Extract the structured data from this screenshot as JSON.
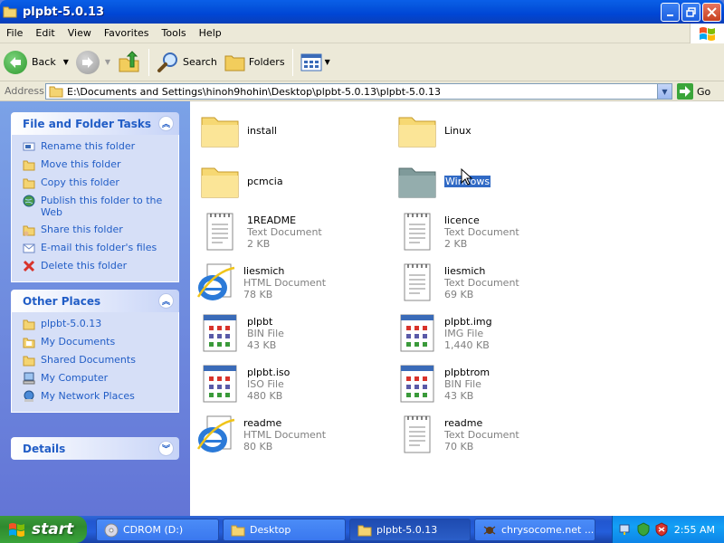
{
  "window": {
    "title": "plpbt-5.0.13"
  },
  "menu": [
    "File",
    "Edit",
    "View",
    "Favorites",
    "Tools",
    "Help"
  ],
  "toolbar": {
    "back": "Back",
    "search": "Search",
    "folders": "Folders"
  },
  "address": {
    "label": "Address",
    "path": "E:\\Documents and Settings\\hinoh9hohin\\Desktop\\plpbt-5.0.13\\plpbt-5.0.13",
    "go": "Go"
  },
  "tasks_panel": {
    "title": "File and Folder Tasks",
    "items": [
      "Rename this folder",
      "Move this folder",
      "Copy this folder",
      "Publish this folder to the Web",
      "Share this folder",
      "E-mail this folder's files",
      "Delete this folder"
    ]
  },
  "places_panel": {
    "title": "Other Places",
    "items": [
      "plpbt-5.0.13",
      "My Documents",
      "Shared Documents",
      "My Computer",
      "My Network Places"
    ]
  },
  "details_panel": {
    "title": "Details"
  },
  "files": [
    {
      "name": "install",
      "type": "",
      "size": "",
      "icon": "folder-icon"
    },
    {
      "name": "Linux",
      "type": "",
      "size": "",
      "icon": "folder-icon"
    },
    {
      "name": "pcmcia",
      "type": "",
      "size": "",
      "icon": "folder-icon"
    },
    {
      "name": "Windows",
      "type": "",
      "size": "",
      "icon": "folder-icon"
    },
    {
      "name": "1README",
      "type": "Text Document",
      "size": "2 KB",
      "icon": "text-document-icon"
    },
    {
      "name": "licence",
      "type": "Text Document",
      "size": "2 KB",
      "icon": "text-document-icon"
    },
    {
      "name": "liesmich",
      "type": "HTML Document",
      "size": "78 KB",
      "icon": "ie-html-icon"
    },
    {
      "name": "liesmich",
      "type": "Text Document",
      "size": "69 KB",
      "icon": "text-document-icon"
    },
    {
      "name": "plpbt",
      "type": "BIN File",
      "size": "43 KB",
      "icon": "binary-file-icon"
    },
    {
      "name": "plpbt.img",
      "type": "IMG File",
      "size": "1,440 KB",
      "icon": "binary-file-icon"
    },
    {
      "name": "plpbt.iso",
      "type": "ISO File",
      "size": "480 KB",
      "icon": "binary-file-icon"
    },
    {
      "name": "plpbtrom",
      "type": "BIN File",
      "size": "43 KB",
      "icon": "binary-file-icon"
    },
    {
      "name": "readme",
      "type": "HTML Document",
      "size": "80 KB",
      "icon": "ie-html-icon"
    },
    {
      "name": "readme",
      "type": "Text Document",
      "size": "70 KB",
      "icon": "text-document-icon"
    }
  ],
  "taskbar": {
    "start": "start",
    "buttons": [
      "CDROM (D:)",
      "Desktop",
      "plpbt-5.0.13",
      "chrysocome.net ..."
    ],
    "clock": "2:55 AM"
  },
  "colors": {
    "selection": "#316ac5",
    "link": "#215dc6",
    "titlebar": "#0058e6"
  }
}
